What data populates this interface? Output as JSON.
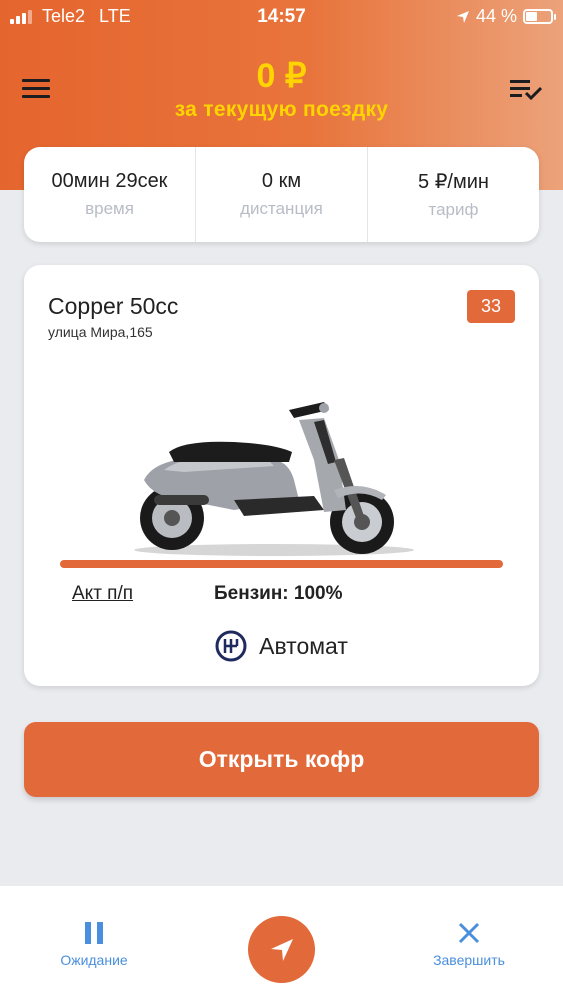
{
  "status_bar": {
    "carrier": "Tele2",
    "network": "LTE",
    "time": "14:57",
    "battery": "44 %",
    "battery_level": 0.44
  },
  "header": {
    "amount": "0 ₽",
    "subtitle": "за текущую поездку"
  },
  "stats": [
    {
      "value": "00мин 29сек",
      "label": "время"
    },
    {
      "value": "0 км",
      "label": "дистанция"
    },
    {
      "value": "5 ₽/мин",
      "label": "тариф"
    }
  ],
  "scooter": {
    "name": "Copper 50cc",
    "address": "улица Мира,165",
    "badge": "33",
    "fuel_level": 1.0,
    "act_link": "Акт п/п",
    "fuel_text": "Бензин: 100%",
    "transmission": "Автомат"
  },
  "actions": {
    "open_trunk": "Открыть кофр"
  },
  "bottom_bar": {
    "pause_label": "Ожидание",
    "finish_label": "Завершить"
  },
  "colors": {
    "accent": "#e2693a",
    "yellow": "#ffd400",
    "blue": "#4a8fdd"
  }
}
